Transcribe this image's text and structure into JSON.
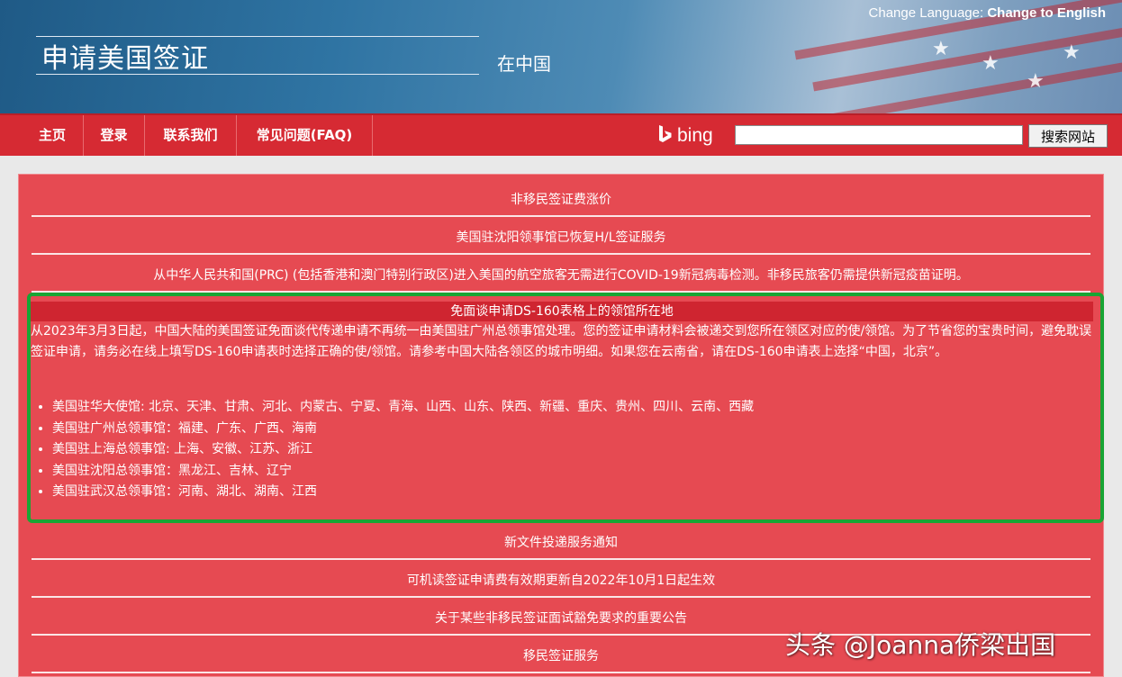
{
  "header": {
    "title": "申请美国签证",
    "subtitle": "在中国",
    "change_language_label": "Change Language:",
    "change_language_link": "Change to English"
  },
  "nav": {
    "items": [
      "主页",
      "登录",
      "联系我们",
      "常见问题(FAQ)"
    ],
    "search_brand": "bing",
    "search_value": "",
    "search_button": "搜索网站"
  },
  "notices_top": [
    "非移民签证费涨价",
    "美国驻沈阳领事馆已恢复H/L签证服务",
    "从中华人民共和国(PRC) (包括香港和澳门特别行政区)进入美国的航空旅客无需进行COVID-19新冠病毒检测。非移民旅客仍需提供新冠疫苗证明。"
  ],
  "highlight": {
    "title": "免面谈申请DS-160表格上的领馆所在地",
    "body": "从2023年3月3日起，中国大陆的美国签证免面谈代传递申请不再统一由美国驻广州总领事馆处理。您的签证申请材料会被递交到您所在领区对应的使/领馆。为了节省您的宝贵时间，避免耽误签证申请，请务必在线上填写DS-160申请表时选择正确的使/领馆。请参考中国大陆各领区的城市明细。如果您在云南省，请在DS-160申请表上选择“中国，北京”。",
    "posts": [
      "美国驻华大使馆: 北京、天津、甘肃、河北、内蒙古、宁夏、青海、山西、山东、陕西、新疆、重庆、贵州、四川、云南、西藏",
      "美国驻广州总领事馆：福建、广东、广西、海南",
      "美国驻上海总领事馆: 上海、安徽、江苏、浙江",
      "美国驻沈阳总领事馆：黑龙江、吉林、辽宁",
      "美国驻武汉总领事馆：河南、湖北、湖南、江西"
    ]
  },
  "notices_bottom": [
    "新文件投递服务通知",
    "可机读签证申请费有效期更新自2022年10月1日起生效",
    "关于某些非移民签证面试豁免要求的重要公告",
    "移民签证服务"
  ],
  "watermark": "头条 @Joanna侨梁出国",
  "colors": {
    "nav_red": "#d62a33",
    "panel_red": "#e64a52",
    "highlight_green": "#19a534"
  }
}
